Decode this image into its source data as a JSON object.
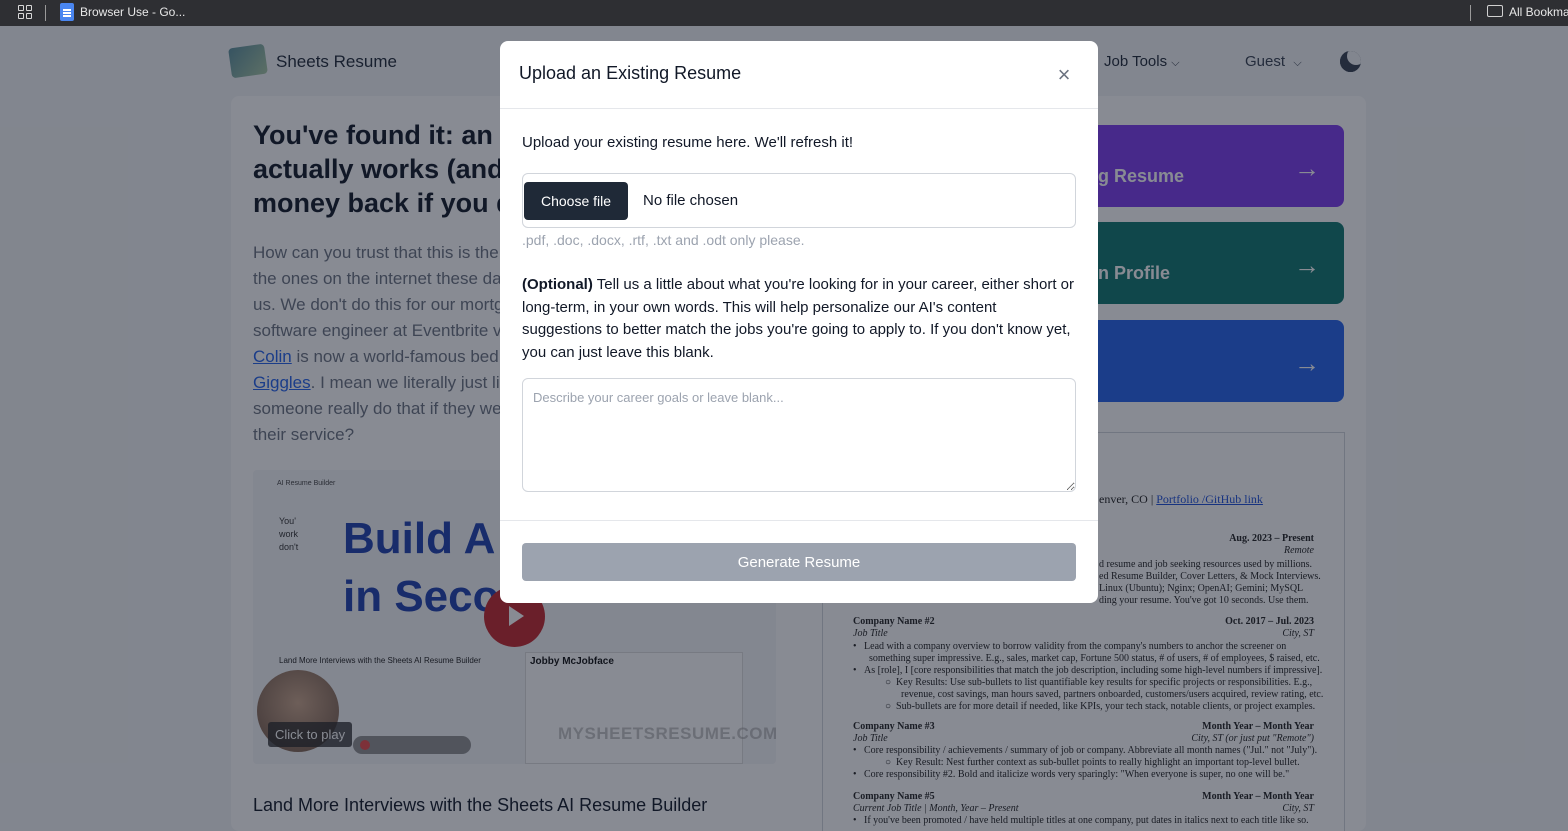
{
  "browser": {
    "tab_title": "Browser Use - Go...",
    "bookmarks_label": "All Bookma"
  },
  "site": {
    "brand": "Sheets Resume",
    "nav_job_tools": "Job Tools",
    "nav_guest": "Guest"
  },
  "hero": {
    "title_lines": [
      "You've found it: an A",
      "actually works (and t",
      "money back if you do"
    ],
    "body_lines": [
      "How can you trust that this is the",
      "the ones on the internet these da",
      "us. We don't do this for our mortg",
      "software engineer at Eventbrite v"
    ],
    "link_colin": "Colin",
    "body_after_colin": " is now a world-famous bed",
    "link_giggles": "Giggles",
    "body_after_giggles": ". I mean we literally just lir",
    "body_tail": [
      "someone really do that if they we",
      "their service?"
    ]
  },
  "video": {
    "top_label": "AI Resume Builder",
    "headline_1": "Build A",
    "headline_2": "in Secon",
    "section_label": "Land More Interviews with the Sheets AI Resume Builder",
    "resume_name": "Jobby McJobface",
    "side_text": [
      "You'",
      "work",
      "don't"
    ],
    "click_to_play": "Click to play",
    "watermark": "MYSHEETSRESUME.COM"
  },
  "section_title": "Land More Interviews with the Sheets AI Resume Builder",
  "actions": [
    {
      "label": "g Resume",
      "color": "#7c3aed"
    },
    {
      "label": "n Profile",
      "color": "#0f766e"
    },
    {
      "label": "",
      "color": "#2563eb"
    }
  ],
  "resume_preview": {
    "header_text": "enver, CO |",
    "header_link": "Portfolio /GitHub link",
    "job1_dates": "Aug. 2023 – Present",
    "job1_loc": "Remote",
    "job1_lines": [
      "d resume and job seeking resources used by millions.",
      "ed Resume Builder, Cover Letters, & Mock Interviews.",
      "Linux (Ubuntu); Nginx; OpenAI; Gemini; MySQL",
      "ding your resume. You've got 10 seconds. Use them."
    ],
    "job2_name": "Company Name #2",
    "job2_title": "Job Title",
    "job2_dates": "Oct. 2017 – Jul. 2023",
    "job2_loc": "City, ST",
    "job2_lines": [
      "Lead with a company overview to borrow validity from the company's numbers to anchor the screener on",
      "something super impressive. E.g., sales, market cap, Fortune 500 status, # of users, # of employees, $ raised, etc.",
      "As [role], I [core responsibilities that match the job description, including some high-level numbers if impressive].",
      "Key Results: Use sub-bullets to list quantifiable key results for specific projects or responsibilities. E.g.,",
      "revenue, cost savings, man hours saved, partners onboarded, customers/users acquired, review rating, etc.",
      "Sub-bullets are for more detail if needed, like KPIs, your tech stack, notable clients, or project examples."
    ],
    "job3_name": "Company Name #3",
    "job3_title": "Job Title",
    "job3_dates": "Month Year – Month Year",
    "job3_loc": "City, ST (or just put \"Remote\")",
    "job3_lines": [
      "Core responsibility / achievements / summary of job or company. Abbreviate all month names (\"Jul.\" not \"July\").",
      "Key Result: Nest further context as sub-bullet points to really highlight an important top-level bullet.",
      "Core responsibility #2. Bold and italicize words very sparingly: \"When everyone is super, no one will be.\""
    ],
    "job5_name": "Company Name #5",
    "job5_title": "Current Job Title | Month, Year – Present",
    "job5_dates": "Month Year – Month Year",
    "job5_loc": "City, ST",
    "job5_lines": [
      "If you've been promoted / have held multiple titles at one company, put dates in italics next to each title like so."
    ]
  },
  "modal": {
    "title": "Upload an Existing Resume",
    "intro": "Upload your existing resume here. We'll refresh it!",
    "choose_file": "Choose file",
    "file_status": "No file chosen",
    "file_hint": ".pdf, .doc, .docx, .rtf, .txt and .odt only please.",
    "optional_label": "(Optional)",
    "optional_text": " Tell us a little about what you're looking for in your career, either short or long-term, in your own words. This will help personalize our AI's content suggestions to better match the jobs you're going to apply to. If you don't know yet, you can just leave this blank.",
    "goals_placeholder": "Describe your career goals or leave blank...",
    "goals_value": "",
    "generate_label": "Generate Resume"
  },
  "colors": {
    "overlay": "#111827",
    "primary_dark": "#1f2937",
    "disabled_button": "#9ca3af",
    "link": "#2563eb"
  }
}
